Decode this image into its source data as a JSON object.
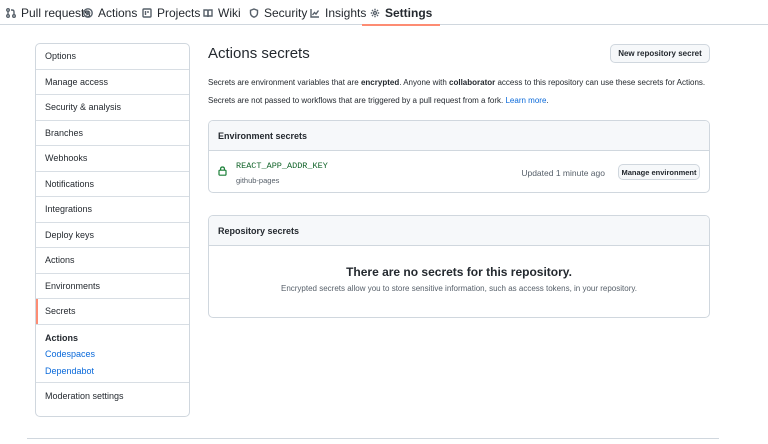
{
  "nav": {
    "items": [
      {
        "label": "Pull requests",
        "icon": "pull-request-icon"
      },
      {
        "label": "Actions",
        "icon": "play-icon"
      },
      {
        "label": "Projects",
        "icon": "project-icon"
      },
      {
        "label": "Wiki",
        "icon": "book-icon"
      },
      {
        "label": "Security",
        "icon": "shield-icon"
      },
      {
        "label": "Insights",
        "icon": "graph-icon"
      },
      {
        "label": "Settings",
        "icon": "gear-icon"
      }
    ],
    "active": "Settings",
    "accent": "#fd8c73"
  },
  "sidebar": {
    "items": [
      {
        "label": "Options"
      },
      {
        "label": "Manage access"
      },
      {
        "label": "Security & analysis"
      },
      {
        "label": "Branches"
      },
      {
        "label": "Webhooks"
      },
      {
        "label": "Notifications"
      },
      {
        "label": "Integrations"
      },
      {
        "label": "Deploy keys"
      },
      {
        "label": "Actions"
      },
      {
        "label": "Environments"
      },
      {
        "label": "Secrets"
      }
    ],
    "selected": "Secrets",
    "group": {
      "title": "Actions",
      "links": [
        "Codespaces",
        "Dependabot"
      ]
    },
    "last_item": "Moderation settings"
  },
  "main": {
    "title": "Actions secrets",
    "new_secret_button": "New repository secret",
    "desc1": {
      "p1": "Secrets are environment variables that are ",
      "b1": "encrypted",
      "p2": ". Anyone with ",
      "b2": "collaborator",
      "p3": " access to this repository can use these secrets for Actions."
    },
    "desc2": {
      "text": "Secrets are not passed to workflows that are triggered by a pull request from a fork. ",
      "link": "Learn more",
      "end": "."
    },
    "environment_secrets": {
      "header": "Environment secrets",
      "secret": {
        "name": "REACT_APP_ADDR_KEY",
        "environment": "github-pages",
        "updated": "Updated 1 minute ago",
        "manage_button": "Manage environment"
      }
    },
    "repository_secrets": {
      "header": "Repository secrets",
      "empty_title": "There are no secrets for this repository.",
      "empty_text": "Encrypted secrets allow you to store sensitive information, such as access tokens, in your repository."
    }
  },
  "colors": {
    "link": "#0969da",
    "secret_name": "#116329",
    "border": "#d0d7de"
  }
}
